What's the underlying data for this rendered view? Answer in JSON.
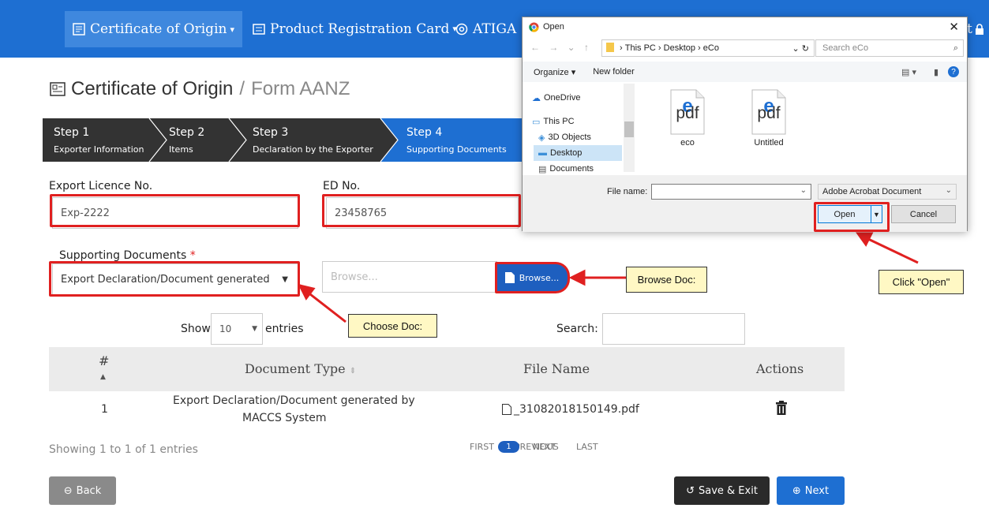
{
  "nav": {
    "item1": "Certificate of Origin",
    "item2": "Product Registration Card",
    "item3": "ATIGA",
    "right_letter": "t"
  },
  "title": {
    "main": "Certificate of Origin",
    "sep": "/",
    "sub": "Form AANZ"
  },
  "steps": [
    {
      "title": "Step 1",
      "subtitle": "Exporter Information"
    },
    {
      "title": "Step 2",
      "subtitle": "Items"
    },
    {
      "title": "Step 3",
      "subtitle": "Declaration by the Exporter"
    },
    {
      "title": "Step 4",
      "subtitle": "Supporting Documents"
    }
  ],
  "form": {
    "export_licence_label": "Export Licence No.",
    "export_licence_value": "Exp-2222",
    "ed_label": "ED No.",
    "ed_value": "23458765",
    "supporting_label": "Supporting Documents",
    "required_mark": "*",
    "doc_select_value": "Export Declaration/Document generated",
    "browse_placeholder": "Browse...",
    "browse_button": "Browse..."
  },
  "callouts": {
    "browse": "Browse Doc:",
    "choose": "Choose Doc:",
    "open": "Click \"Open\""
  },
  "table_controls": {
    "show": "Show",
    "entries_value": "10",
    "entries": "entries",
    "search": "Search:"
  },
  "table": {
    "headers": {
      "num": "#",
      "type": "Document Type",
      "file": "File Name",
      "actions": "Actions"
    },
    "rows": [
      {
        "num": "1",
        "type_line1": "Export Declaration/Document generated by",
        "type_line2": "MACCS System",
        "file": "_31082018150149.pdf"
      }
    ]
  },
  "pager": {
    "info": "Showing 1 to 1 of 1 entries",
    "first": "FIRST",
    "previous": "PREVIOUS",
    "page": "1",
    "next": "NEXT",
    "last": "LAST"
  },
  "buttons": {
    "back": "Back",
    "save_exit": "Save & Exit",
    "next": "Next"
  },
  "dialog": {
    "title": "Open",
    "path": [
      "This PC",
      "Desktop",
      "eCo"
    ],
    "search_placeholder": "Search eCo",
    "organize": "Organize",
    "new_folder": "New folder",
    "tree": [
      "OneDrive",
      "This PC",
      "3D Objects",
      "Desktop",
      "Documents"
    ],
    "files": [
      {
        "icon_text": "pdf",
        "name": "eco"
      },
      {
        "icon_text": "pdf",
        "name": "Untitled"
      }
    ],
    "file_name_label": "File name:",
    "file_type": "Adobe Acrobat Document",
    "open": "Open",
    "cancel": "Cancel"
  },
  "colors": {
    "nav": "#1e6fd2",
    "step_dark": "#333333",
    "step_active": "#1e6fd2",
    "highlight": "#e02020",
    "callout": "#fff8c4"
  }
}
